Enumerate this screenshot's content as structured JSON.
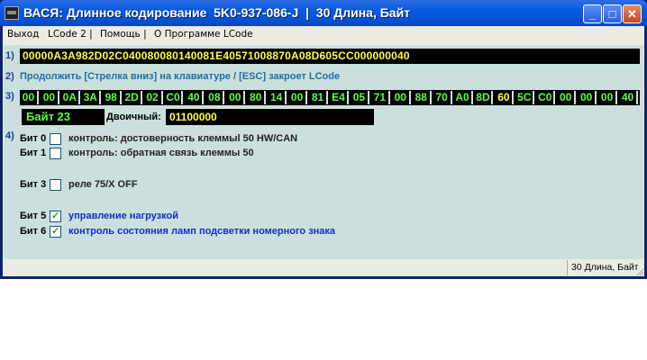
{
  "window": {
    "title": "ВАСЯ: Длинное кодирование  5K0-937-086-J  |  30 Длина, Байт",
    "minimize": "_",
    "maximize": "□",
    "close": "✕"
  },
  "menu": [
    "Выход",
    "LCode 2 |",
    "Помощь |",
    "О Программе LCode"
  ],
  "steps": {
    "s1": "1)",
    "s2": "2)",
    "s3": "3)",
    "s4": "4)"
  },
  "coding": {
    "full_hex": "00000A3A982D02C04008008014008 1E40571008870A08D605CC000000040"
  },
  "hint": "Продолжить [Стрелка вниз] на клавиатуре / [ESC] закроет LCode",
  "bytes": [
    "00",
    "00",
    "0A",
    "3A",
    "98",
    "2D",
    "02",
    "C0",
    "40",
    "08",
    "00",
    "80",
    "14",
    "00",
    "81",
    "E4",
    "05",
    "71",
    "00",
    "88",
    "70",
    "A0",
    "8D",
    "60",
    "5C",
    "C0",
    "00",
    "00",
    "00",
    "40"
  ],
  "selected_byte_index": 23,
  "byte_label": "Байт 23",
  "binary_label": "Двоичный:",
  "binary_value": "01100000",
  "bits": [
    {
      "label": "Бит 0",
      "checked": false,
      "desc": "контроль: достоверность клеммыl 50 HW/CAN"
    },
    {
      "label": "Бит 1",
      "checked": false,
      "desc": "контроль: обратная связь клеммы 50"
    },
    {
      "label": "Бит 3",
      "checked": false,
      "desc": "реле 75/X OFF"
    },
    {
      "label": "Бит 5",
      "checked": true,
      "desc": "управление нагрузкой"
    },
    {
      "label": "Бит 6",
      "checked": true,
      "desc": "контроль состояния ламп подсветки номерного знака"
    }
  ],
  "status": "30 Длина, Байт",
  "colors": {
    "title_bar": "#0654d8",
    "panel_bg": "#cbe0dc",
    "hex_text": "#ffff40",
    "byte_text": "#5cff3c",
    "hint_text": "#1e6ea8",
    "checked_desc": "#1030c0"
  }
}
